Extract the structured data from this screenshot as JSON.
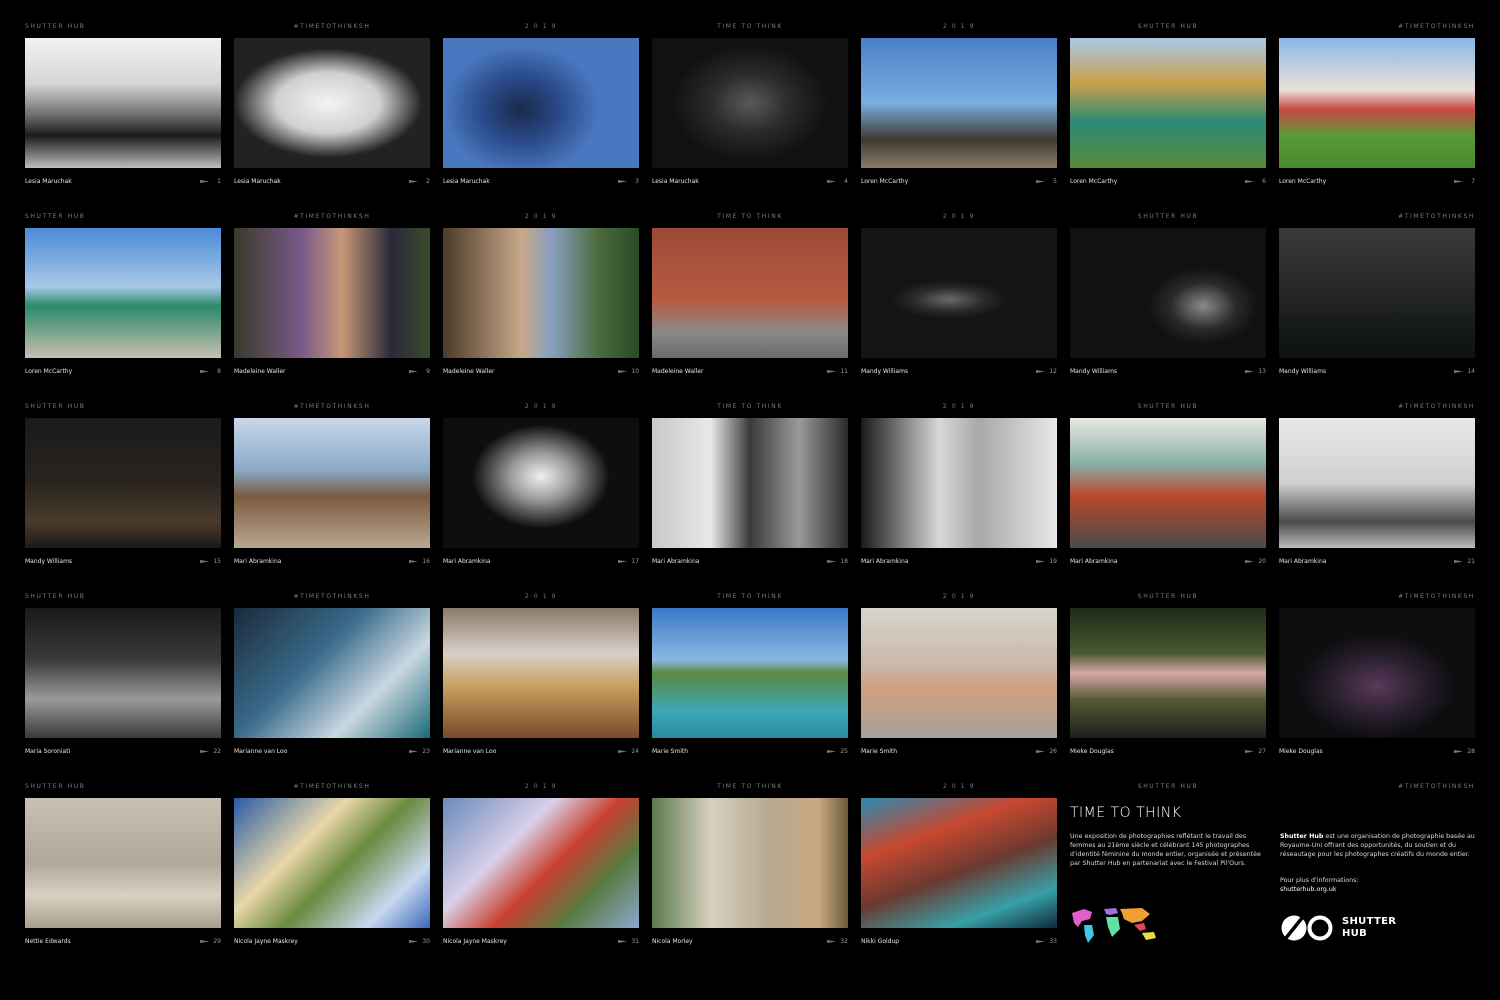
{
  "header_labels": [
    "SHUTTER HUB",
    "#TIMETOTHINKSH",
    "2 0 1 9",
    "TIME TO THINK",
    "2 0 1 9",
    "SHUTTER HUB",
    "#TIMETOTHINKSH"
  ],
  "photos": [
    {
      "num": "1",
      "name": "Lesia Maruchak",
      "bg": "linear-gradient(180deg,#f2f2f2 0%,#d6d6d6 35%,#6b6b6b 60%,#1a1a1a 75%,#bdbdbd 100%)"
    },
    {
      "num": "2",
      "name": "Lesia Maruchak",
      "bg": "radial-gradient(ellipse 48% 42% at 48% 50%,#f4f4f4 0%,#d0d0d0 55%,#222 100%)"
    },
    {
      "num": "3",
      "name": "Lesia Maruchak",
      "bg": "radial-gradient(ellipse 40% 50% at 40% 55%,#1a2a4a 0%,#2a4a8a 50%,#4a78c0 100%)"
    },
    {
      "num": "4",
      "name": "Lesia Maruchak",
      "bg": "radial-gradient(ellipse 40% 45% at 50% 50%,#5a5a5a 0%,#2b2b2b 50%,#111 100%)"
    },
    {
      "num": "5",
      "name": "Loren McCarthy",
      "bg": "linear-gradient(180deg,#4a7fc8 0%,#7aaee0 50%,#3f3a35 78%,#8a7a68 100%)"
    },
    {
      "num": "6",
      "name": "Loren McCarthy",
      "bg": "linear-gradient(180deg,#a9c8e8 0%,#c8a048 35%,#2b8a78 65%,#5a8a38 100%)"
    },
    {
      "num": "7",
      "name": "Loren McCarthy",
      "bg": "linear-gradient(180deg,#8ab8e8 0%,#e8e0d8 40%,#c84840 55%,#5a9a3a 75%,#4a8a30 100%)"
    },
    {
      "num": "8",
      "name": "Loren McCarthy",
      "bg": "linear-gradient(180deg,#4a8ad8 0%,#a8c8e8 45%,#2a8a6a 60%,#c8c0b0 100%)"
    },
    {
      "num": "9",
      "name": "Madeleine Waller",
      "bg": "linear-gradient(90deg,#3a3a2a 0%,#7a5a8a 35%,#c89878 55%,#2a2a3a 80%,#3a4a2a 100%)"
    },
    {
      "num": "10",
      "name": "Madeleine Waller",
      "bg": "linear-gradient(90deg,#4a3a2a 0%,#c8a888 40%,#8aa0c0 55%,#4a6a3a 80%,#2a4a2a 100%)"
    },
    {
      "num": "11",
      "name": "Madeleine Waller",
      "bg": "linear-gradient(180deg,#9a4a38 0%,#b85a40 55%,#8a8a88 80%,#6a6a68 100%)"
    },
    {
      "num": "12",
      "name": "Mandy Williams",
      "bg": "radial-gradient(ellipse 30% 15% at 45% 55%,#6a6a6a 0%,#2a2a2a 60%,#141414 100%)"
    },
    {
      "num": "13",
      "name": "Mandy Williams",
      "bg": "radial-gradient(ellipse 28% 30% at 68% 60%,#8a8a8a 0%,#2a2a2a 60%,#111 100%)"
    },
    {
      "num": "14",
      "name": "Mandy Williams",
      "bg": "linear-gradient(180deg,#3a3a3a 0%,#2a2a2a 40%,#1a1e1a 70%,#0e120e 100%)"
    },
    {
      "num": "15",
      "name": "Mandy Williams",
      "bg": "linear-gradient(180deg,#1a1a1a 0%,#2a2420 50%,#4a3a2a 80%,#1a1a1a 100%)"
    },
    {
      "num": "16",
      "name": "Mari Abramkina",
      "bg": "linear-gradient(180deg,#c8d8e8 0%,#8aa8c8 40%,#7a5a40 60%,#b8a890 100%)"
    },
    {
      "num": "17",
      "name": "Mari Abramkina",
      "bg": "radial-gradient(ellipse 35% 40% at 50% 45%,#f0f0f0 0%,#9a9a9a 45%,#0e0e0e 100%)"
    },
    {
      "num": "18",
      "name": "Mari Abramkina",
      "bg": "linear-gradient(90deg,#c8c8c8 0%,#e8e8e8 30%,#3a3a3a 50%,#9a9a9a 75%,#2a2a2a 100%)"
    },
    {
      "num": "19",
      "name": "Mari Abramkina",
      "bg": "linear-gradient(90deg,#1a1a1a 0%,#d8d8d8 40%,#a8a8a8 60%,#e8e8e8 100%)"
    },
    {
      "num": "20",
      "name": "Mari Abramkina",
      "bg": "linear-gradient(180deg,#e8e8e0 0%,#8ab0a8 35%,#b8482a 60%,#4a4a48 100%)"
    },
    {
      "num": "21",
      "name": "Mari Abramkina",
      "bg": "linear-gradient(180deg,#e8e8e8 0%,#d0d0d0 50%,#4a4a4a 80%,#bcbcbc 100%)"
    },
    {
      "num": "22",
      "name": "Maria Soroniati",
      "bg": "linear-gradient(180deg,#1a1a1a 0%,#3a3a3a 40%,#9a9a9a 70%,#3a3a3a 100%)"
    },
    {
      "num": "23",
      "name": "Marianne van Loo",
      "bg": "linear-gradient(135deg,#1a2a3a 0%,#3a6a8a 40%,#c8d8e0 70%,#1a6a78 100%)"
    },
    {
      "num": "24",
      "name": "Marianne van Loo",
      "bg": "linear-gradient(180deg,#8a7a6a 0%,#d8d0c8 35%,#c8a060 60%,#7a4a2a 100%)"
    },
    {
      "num": "25",
      "name": "Marie Smith",
      "bg": "linear-gradient(180deg,#3a78c8 0%,#8ab8e0 40%,#5a8a40 50%,#3aa8b8 80%,#2a8aa0 100%)"
    },
    {
      "num": "26",
      "name": "Marie Smith",
      "bg": "linear-gradient(180deg,#d8d4cc 0%,#c8b8a8 45%,#d0a080 60%,#a8a098 100%)"
    },
    {
      "num": "27",
      "name": "Mieke Douglas",
      "bg": "linear-gradient(180deg,#1e2a18 0%,#4a5a30 35%,#d8a8a8 50%,#5a5a3a 70%,#1a2018 100%)"
    },
    {
      "num": "28",
      "name": "Mieke Douglas",
      "bg": "radial-gradient(ellipse 40% 40% at 50% 60%,#5a3a5a 0%,#2a2030 55%,#0e0e10 100%)"
    },
    {
      "num": "29",
      "name": "Nettie Edwards",
      "bg": "linear-gradient(180deg,#c8c0b0 0%,#b0a898 50%,#d8d0c0 75%,#a89e8c 100%)"
    },
    {
      "num": "30",
      "name": "Nicola Jayne Maskrey",
      "bg": "linear-gradient(135deg,#2a5aa8 0%,#e8d8a8 35%,#6a8a40 55%,#c8d8f0 80%,#3a68b8 100%)"
    },
    {
      "num": "31",
      "name": "Nicola Jayne Maskrey",
      "bg": "linear-gradient(135deg,#6a8ab8 0%,#d8d0e8 35%,#c84030 55%,#5a7a40 75%,#8aa8d0 100%)"
    },
    {
      "num": "32",
      "name": "Nicola Morley",
      "bg": "linear-gradient(90deg,#5a7a4a 0%,#d8d0c0 30%,#b8a890 60%,#c8a880 85%,#6a5a3a 100%)"
    },
    {
      "num": "33",
      "name": "Nikki Goldup",
      "bg": "linear-gradient(160deg,#2a8ab0 0%,#c84830 30%,#6a3a30 55%,#38a0a8 80%,#0e2a38 100%)"
    }
  ],
  "info": {
    "title": "TIME TO THINK",
    "description": "Une exposition de photographies reflétant le travail des femmes au 21ème siècle et célébrant 145 photographes d'identité féminine du monde entier, organisée et présentée par Shutter Hub en partenariat avec le Festival Pil'Ours.",
    "about_bold": "Shutter Hub",
    "about_rest": " est une organisation de photographie basée au Royaume-Uni offrant des opportunités, du soutien et du réseautage pour les photographes créatifs du monde entier.",
    "more_info": "Pour plus d'informations:",
    "url": "shutterhub.org.uk",
    "logo_line1": "SHUTTER",
    "logo_line2": "HUB"
  }
}
